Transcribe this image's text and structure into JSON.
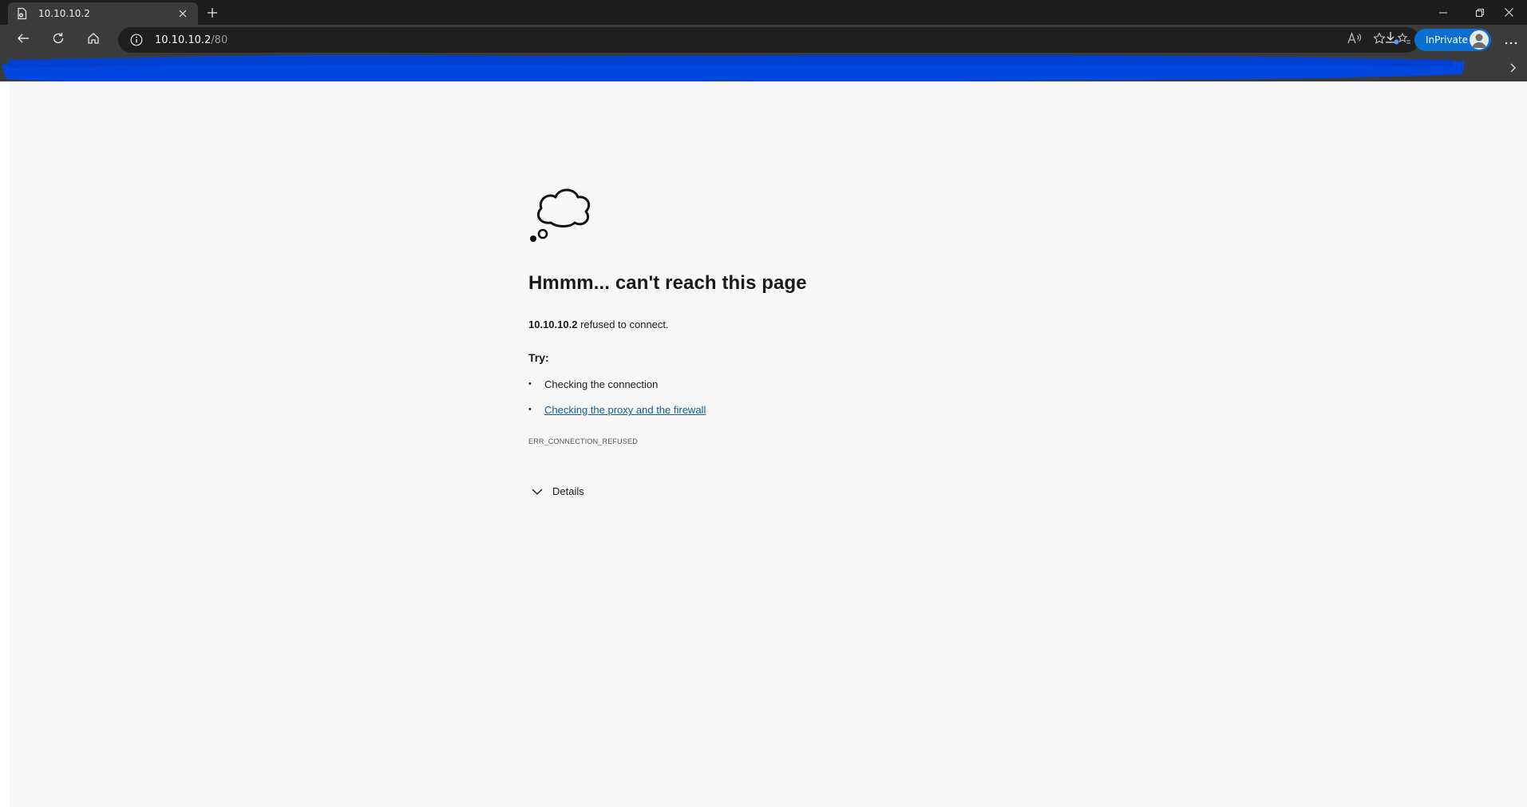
{
  "tab": {
    "title": "10.10.10.2"
  },
  "address": {
    "host": "10.10.10.2",
    "path": "/80"
  },
  "profile": {
    "label": "InPrivate"
  },
  "error": {
    "heading": "Hmmm... can't reach this page",
    "host_bold": "10.10.10.2",
    "message_rest": " refused to connect.",
    "try_label": "Try:",
    "suggestions": [
      "Checking the connection",
      "Checking the proxy and the firewall"
    ],
    "code": "ERR_CONNECTION_REFUSED",
    "details_label": "Details"
  },
  "icons": {
    "tab": "page-error-icon",
    "close": "close-icon",
    "new_tab": "plus-icon",
    "back": "back-arrow-icon",
    "refresh": "refresh-icon",
    "home": "home-icon",
    "info": "info-icon",
    "read_aloud": "read-aloud-icon",
    "favorite": "star-icon",
    "downloads": "download-icon",
    "more": "more-icon",
    "cloud": "thought-cloud-icon",
    "details": "chevron-down-icon"
  },
  "colors": {
    "inprivate": "#0a6ed1",
    "link": "#0f5c94",
    "scribble": "#0047e0",
    "page_bg": "#f7f7f7"
  }
}
